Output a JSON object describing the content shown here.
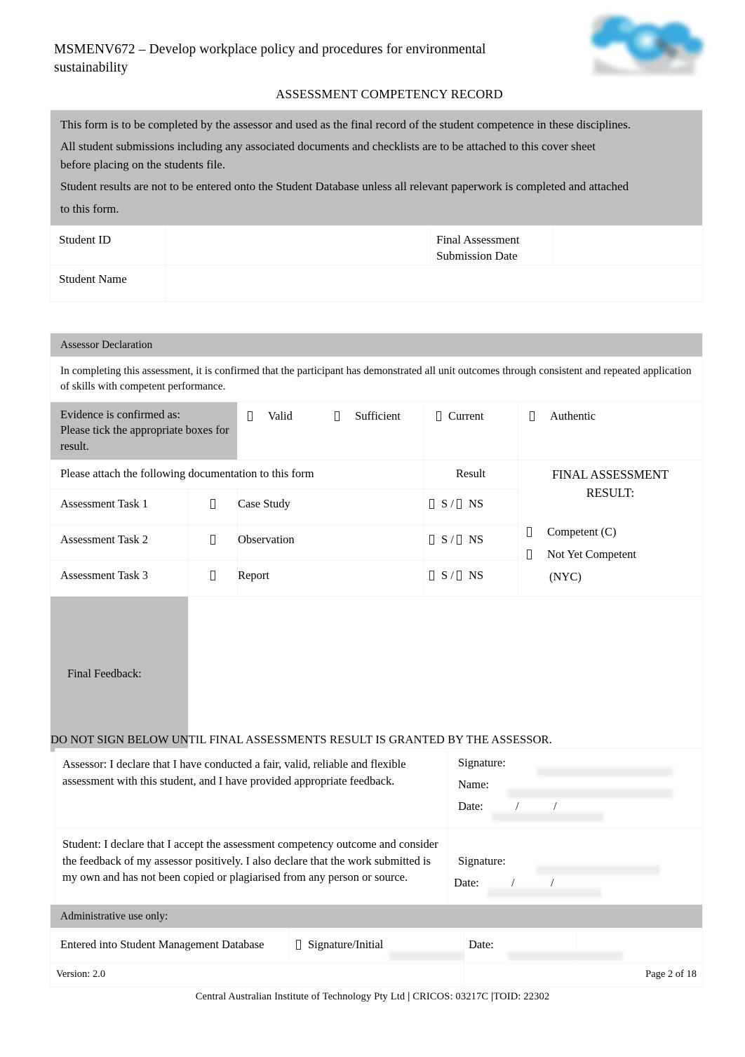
{
  "header": {
    "unit_title": "MSMENV672 – Develop workplace policy and procedures for environmental sustainability",
    "document_title": "ASSESSMENT COMPETENCY RECORD",
    "logo_name": "caiot-logo"
  },
  "instructions": {
    "line1": "This form is to be completed by the assessor and used as the final record of the student competence in these disciplines.",
    "line2": "All student submissions including any associated documents and checklists are to be attached to this cover sheet",
    "line3": "before placing on the students file.",
    "line4": "Student results are not to be entered onto the Student Database unless all relevant paperwork is completed and attached",
    "line5": "to this form."
  },
  "student": {
    "id_label": "Student ID",
    "id_value": "",
    "submission_date_label_line1": "Final Assessment",
    "submission_date_label_line2": "Submission Date",
    "submission_date_value": "",
    "name_label": "Student Name",
    "name_value": ""
  },
  "assessor_declaration": {
    "section_title": "Assessor Declaration",
    "statement": "In completing this assessment, it is confirmed that the participant has demonstrated all unit outcomes through consistent and repeated application of skills with competent performance.",
    "evidence_label_line1": "Evidence is confirmed as:",
    "evidence_label_line2": "Please tick the appropriate boxes for result.",
    "evidence_options": [
      {
        "label": "Valid",
        "checked": false
      },
      {
        "label": "Sufficient",
        "checked": false
      },
      {
        "label": "Current",
        "checked": false
      },
      {
        "label": "Authentic",
        "checked": false
      }
    ],
    "attach_label": "Please attach the following documentation to this form",
    "result_column_header": "Result",
    "final_result_header_line1": "FINAL ASSESSMENT",
    "final_result_header_line2": "RESULT:",
    "tasks": [
      {
        "name": "Assessment Task 1",
        "document": "Case Study",
        "s": "S",
        "ns": "NS",
        "separator": "/"
      },
      {
        "name": "Assessment Task 2",
        "document": "Observation",
        "s": "S",
        "ns": "NS",
        "separator": "/"
      },
      {
        "name": "Assessment Task 3",
        "document": "Report",
        "s": "S",
        "ns": "NS",
        "separator": "/"
      }
    ],
    "final_outcomes": [
      {
        "label": "Competent (C)",
        "checked": false
      },
      {
        "label": "Not Yet Competent",
        "label_cont": "(NYC)",
        "checked": false
      }
    ],
    "feedback_label": "Final Feedback:",
    "feedback_value": ""
  },
  "signing": {
    "warning": "DO NOT SIGN BELOW UNTIL FINAL ASSESSMENTS RESULT IS GRANTED BY THE ASSESSOR.",
    "assessor_declaration": "Assessor:  I declare that I have conducted a fair, valid, reliable and flexible assessment with this student, and I have provided appropriate feedback.",
    "student_declaration": "Student:  I declare that I accept the assessment competency outcome and consider the feedback of my assessor positively. I also declare that the work submitted is my own and has not been copied or plagiarised from any person or source.",
    "signature_label": "Signature:",
    "name_label": "Name:",
    "date_label": "Date:",
    "date_slash": "/",
    "assessor_signature_value": "",
    "assessor_name_value": "",
    "assessor_date_value": "",
    "student_signature_value": "",
    "student_date_value": ""
  },
  "administrative": {
    "section_title": "Administrative use only:",
    "entered_label": "Entered into Student Management Database",
    "entered_checked": false,
    "signature_initial_label": "Signature/Initial",
    "signature_initial_value": "",
    "date_label": "Date:",
    "date_value": ""
  },
  "footer": {
    "version": "Version: 2.0",
    "page": "Page 2 of 18",
    "org": "Central Australian Institute of Technology Pty Ltd",
    "sep1": "|",
    "cricos": "CRICOS: 03217C",
    "sep2": "|",
    "toid": "TOID: 22302"
  },
  "colors": {
    "grey_block": "#bfbfbf",
    "cell_border": "#f4f4f4",
    "fill_grey": "#ececec",
    "logo_blue": "#35a8dd",
    "text": "#000000"
  }
}
